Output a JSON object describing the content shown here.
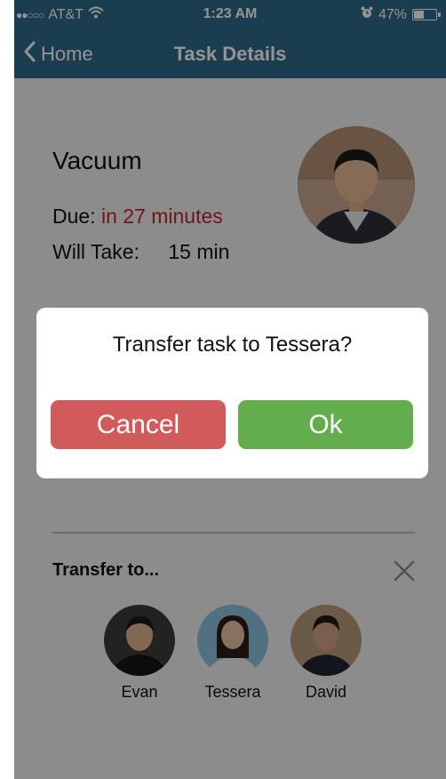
{
  "status_bar": {
    "signal": "●●○○○",
    "carrier": "AT&T",
    "wifi_icon": "wifi-icon",
    "time": "1:23 AM",
    "alarm_icon": "alarm-clock-icon",
    "battery_percent": "47%",
    "battery_level": 0.47
  },
  "nav": {
    "back_label": "Home",
    "title": "Task Details"
  },
  "task": {
    "name": "Vacuum",
    "due_label": "Due:",
    "due_value": "in 27 minutes",
    "takes_label": "Will Take:",
    "takes_value": "15 min"
  },
  "transfer": {
    "label": "Transfer to...",
    "people": [
      {
        "name": "Evan"
      },
      {
        "name": "Tessera"
      },
      {
        "name": "David"
      }
    ]
  },
  "dialog": {
    "message": "Transfer task to Tessera?",
    "cancel_label": "Cancel",
    "ok_label": "Ok"
  },
  "colors": {
    "nav_bg": "#2f6a8a",
    "due_red": "#c0272d",
    "cancel_red": "#d15a5a",
    "ok_green": "#63ad4e"
  }
}
